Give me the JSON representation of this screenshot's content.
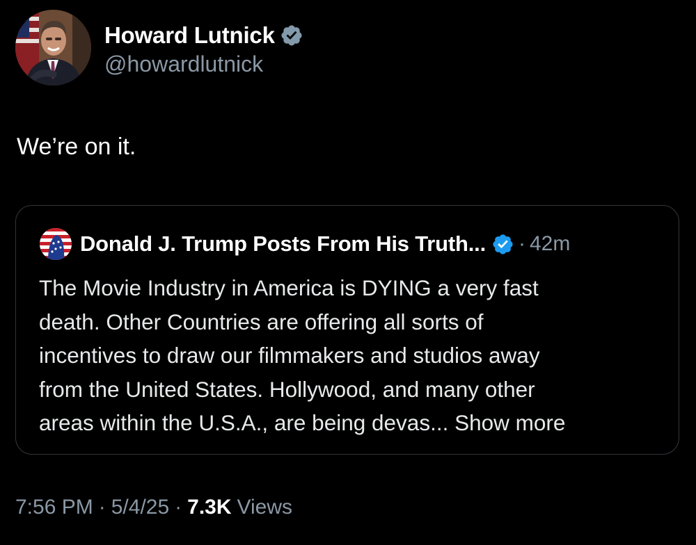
{
  "author": {
    "display_name": "Howard Lutnick",
    "handle": "@howardlutnick",
    "verified_icon": "verified-badge-gray"
  },
  "tweet": {
    "text": "We’re on it."
  },
  "quote": {
    "display_name": "Donald J. Trump Posts From His Truth...",
    "verified_icon": "verified-badge-blue",
    "dot": "·",
    "time": "42m",
    "lines": [
      "The Movie Industry in America is DYING a very fast",
      "death. Other Countries are offering all sorts of",
      "incentives to draw our filmmakers and studios away",
      "from the United States. Hollywood, and many other",
      "areas within the U.S.A., are being devas..."
    ],
    "show_more": "Show more"
  },
  "meta": {
    "time": "7:56 PM",
    "sep1": "·",
    "date": "5/4/25",
    "sep2": "·",
    "views_count": "7.3K",
    "views_label": "Views"
  },
  "colors": {
    "background": "#000000",
    "primary_text": "#e7e9ea",
    "secondary_text": "#8b98a5",
    "card_border": "#33363b",
    "verified_gray": "#829aab",
    "verified_blue": "#1d9bf0"
  }
}
